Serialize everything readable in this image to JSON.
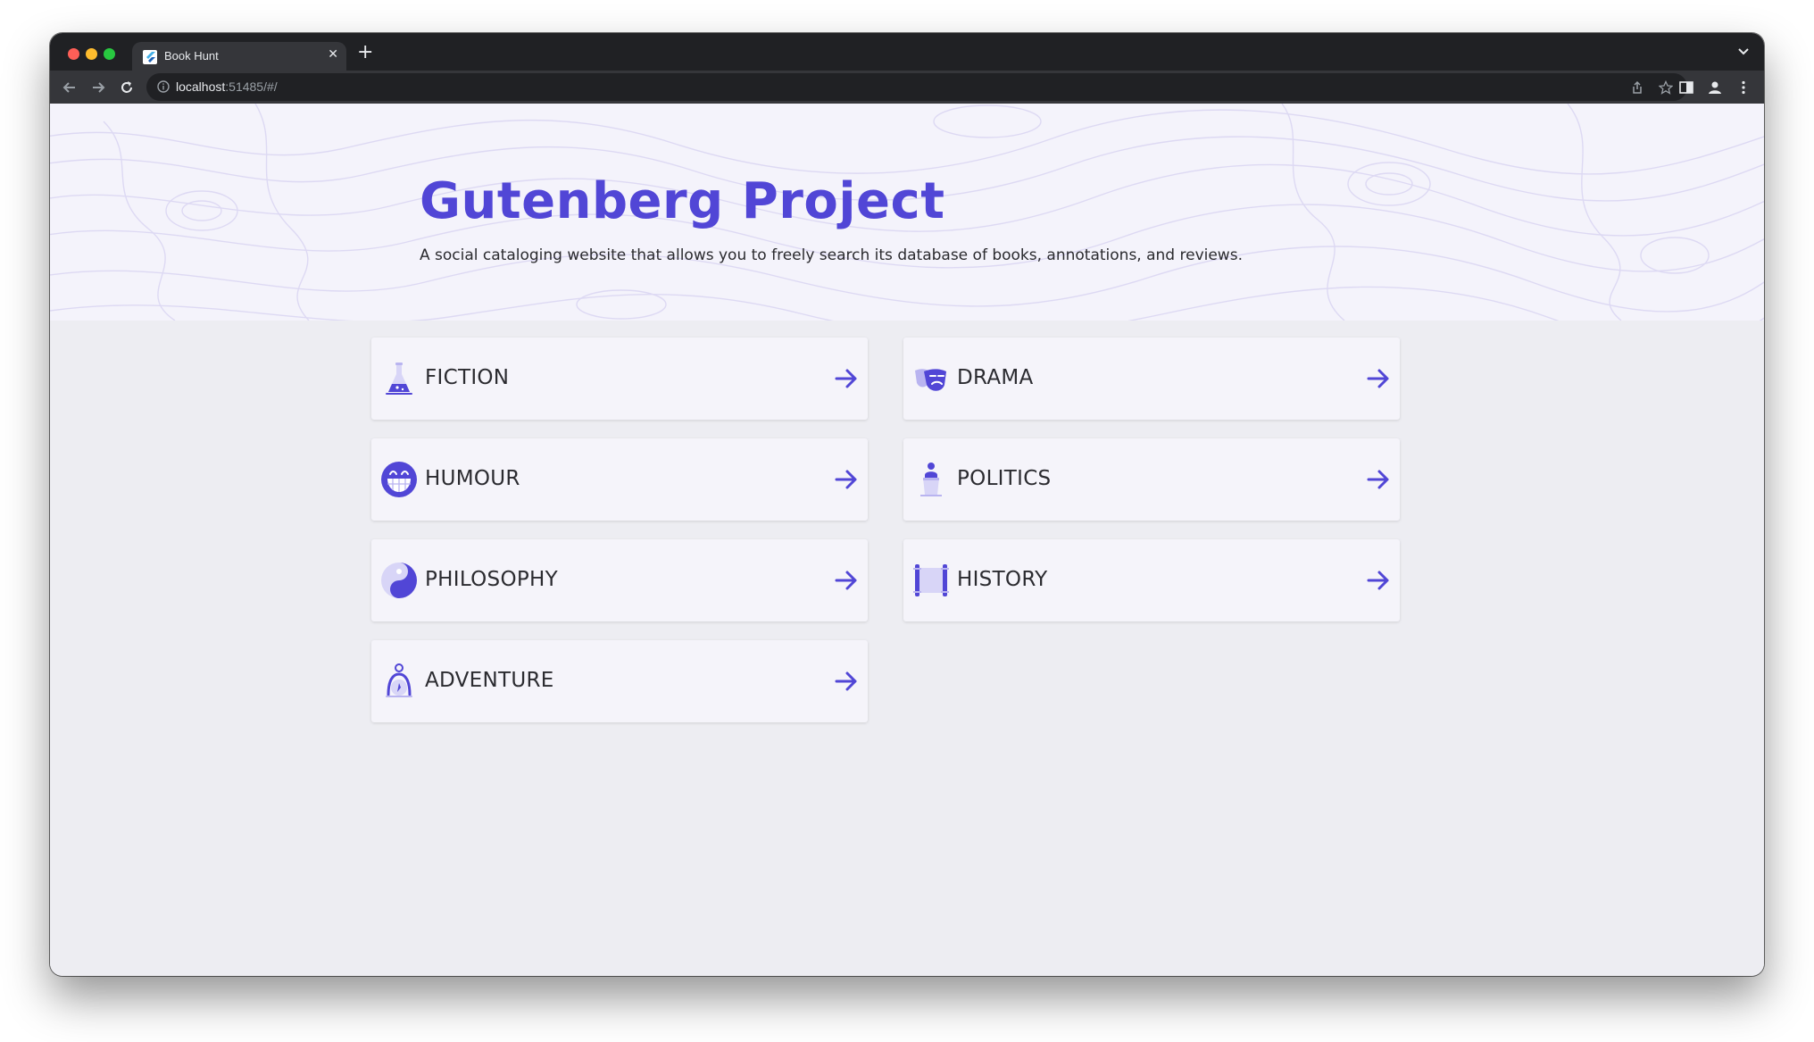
{
  "browser": {
    "tab_title": "Book Hunt",
    "url_host": "localhost",
    "url_rest": ":51485/#/"
  },
  "hero": {
    "title": "Gutenberg Project",
    "subtitle": "A social cataloging website that allows you to freely search its database of books, annotations, and reviews."
  },
  "categories": [
    {
      "label": "FICTION",
      "icon": "flask-icon"
    },
    {
      "label": "DRAMA",
      "icon": "theater-mask-icon"
    },
    {
      "label": "HUMOUR",
      "icon": "grin-face-icon"
    },
    {
      "label": "POLITICS",
      "icon": "podium-person-icon"
    },
    {
      "label": "PHILOSOPHY",
      "icon": "yin-yang-icon"
    },
    {
      "label": "HISTORY",
      "icon": "scroll-icon"
    },
    {
      "label": "ADVENTURE",
      "icon": "compass-person-icon"
    }
  ],
  "colors": {
    "accent": "#5146d6",
    "accent_light": "#b9b4f0",
    "hero_background": "#f4f3fb",
    "page_background": "#ededf2",
    "card_background": "#f5f4fa"
  }
}
